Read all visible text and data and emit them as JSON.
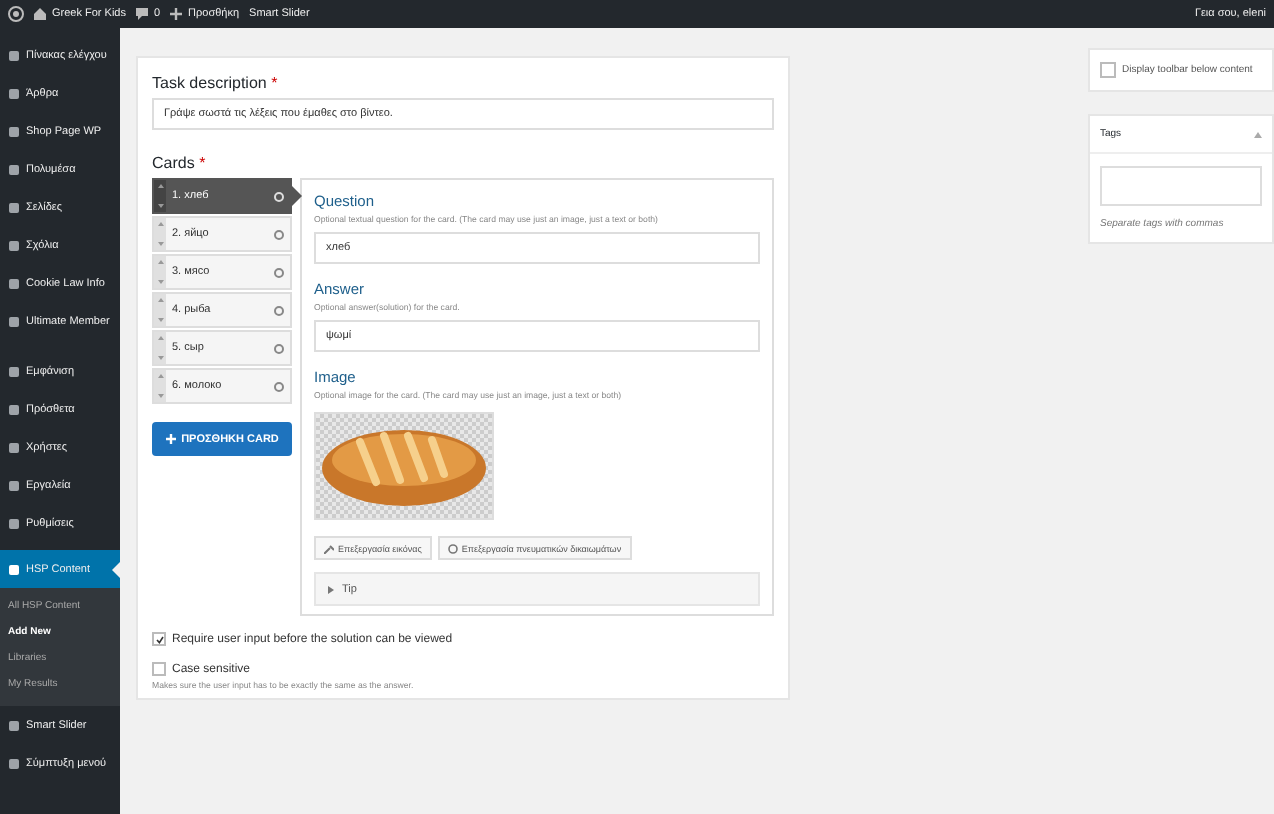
{
  "admin_bar": {
    "site_name": "Greek For Kids",
    "comments_count": "0",
    "new_label": "Προσθήκη",
    "items": [
      "Smart Slider"
    ],
    "greeting": "Γεια σου, eleni"
  },
  "sidebar": {
    "items": [
      {
        "label": "Πίνακας ελέγχου",
        "selected": false
      },
      {
        "label": "Άρθρα",
        "selected": false
      },
      {
        "label": "Shop Page WP",
        "selected": false
      },
      {
        "label": "Πολυμέσα",
        "selected": false
      },
      {
        "label": "Σελίδες",
        "selected": false
      },
      {
        "label": "Σχόλια",
        "selected": false
      },
      {
        "label": "Cookie Law Info",
        "selected": false
      },
      {
        "label": "Ultimate Member",
        "selected": false
      },
      {
        "label": "Εμφάνιση",
        "selected": false
      },
      {
        "label": "Πρόσθετα",
        "selected": false
      },
      {
        "label": "Χρήστες",
        "selected": false
      },
      {
        "label": "Εργαλεία",
        "selected": false
      },
      {
        "label": "Ρυθμίσεις",
        "selected": false
      },
      {
        "label": "HSP Content",
        "selected": true,
        "children": [
          {
            "label": "All HSP Content",
            "selected": false
          },
          {
            "label": "Add New",
            "selected": true
          },
          {
            "label": "Libraries",
            "selected": false
          },
          {
            "label": "My Results",
            "selected": false
          }
        ]
      },
      {
        "label": "Smart Slider",
        "selected": false
      },
      {
        "label": "Σύμπτυξη μενού",
        "selected": false
      }
    ]
  },
  "task": {
    "label": "Task description",
    "required": "*",
    "value": "Γράψε σωστά τις λέξεις που έμαθες στο βίντεο."
  },
  "cards": {
    "label": "Cards",
    "required": "*",
    "items": [
      {
        "label": "1. хлеб",
        "selected": true
      },
      {
        "label": "2. яйцо",
        "selected": false
      },
      {
        "label": "3. мясо",
        "selected": false
      },
      {
        "label": "4. рыба",
        "selected": false
      },
      {
        "label": "5. сыр",
        "selected": false
      },
      {
        "label": "6. молоко",
        "selected": false
      }
    ],
    "add_button": "ΠΡΟΣΘΗΚΗ CARD"
  },
  "question": {
    "title": "Question",
    "description": "Optional textual question for the card. (The card may use just an image, just a text or both)",
    "value": "хлеб"
  },
  "answer": {
    "title": "Answer",
    "description": "Optional answer(solution) for the card.",
    "value": "ψωμί"
  },
  "image": {
    "title": "Image",
    "description": "Optional image for the card. (The card may use just an image, just a text or both)",
    "buttons": [
      "Επεξεργασία εικόνας",
      "Επεξεργασία πνευματικών δικαιωμάτων"
    ],
    "tip": {
      "label": "Tip",
      "expanded": false
    }
  },
  "options": [
    {
      "label": "Require user input before the solution can be viewed",
      "checked": true
    },
    {
      "label": "Case sensitive",
      "checked": false,
      "description": "Makes sure the user input has to be exactly the same as the answer."
    }
  ],
  "right_panel": {
    "toolbar_option": {
      "label": "Display toolbar below content",
      "checked": false
    },
    "tags": {
      "title": "Tags",
      "expanded": true,
      "hint": "Separate tags with commas"
    }
  }
}
